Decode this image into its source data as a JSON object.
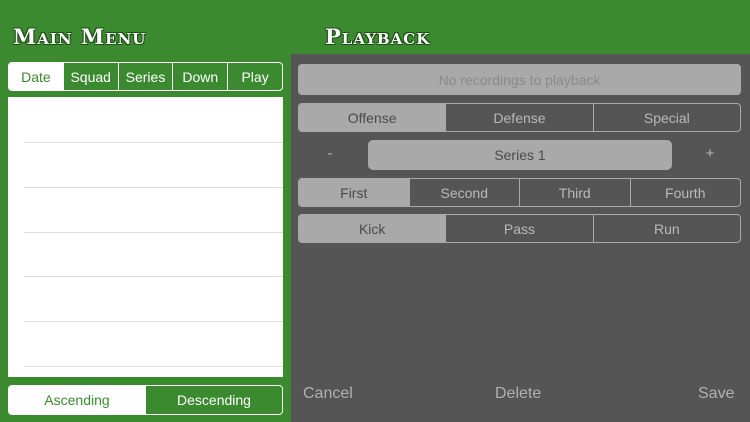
{
  "main_menu": {
    "title": "Main Menu",
    "sort_tabs": [
      {
        "label": "Date",
        "active": true
      },
      {
        "label": "Squad",
        "active": false
      },
      {
        "label": "Series",
        "active": false
      },
      {
        "label": "Down",
        "active": false
      },
      {
        "label": "Play",
        "active": false
      }
    ],
    "order": {
      "ascending_label": "Ascending",
      "descending_label": "Descending",
      "selected": "Descending"
    }
  },
  "playback": {
    "title": "Playback",
    "status_text": "No recordings to playback",
    "unit_tabs": [
      {
        "label": "Offense",
        "active": true
      },
      {
        "label": "Defense",
        "active": false
      },
      {
        "label": "Special",
        "active": false
      }
    ],
    "series": {
      "minus_label": "-",
      "value": "Series 1",
      "plus_label": "+"
    },
    "down_tabs": [
      {
        "label": "First",
        "active": true
      },
      {
        "label": "Second",
        "active": false
      },
      {
        "label": "Third",
        "active": false
      },
      {
        "label": "Fourth",
        "active": false
      }
    ],
    "play_tabs": [
      {
        "label": "Kick",
        "active": true
      },
      {
        "label": "Pass",
        "active": false
      },
      {
        "label": "Run",
        "active": false
      }
    ],
    "actions": {
      "cancel": "Cancel",
      "delete": "Delete",
      "save": "Save"
    }
  },
  "colors": {
    "brand_green": "#3c8a2f",
    "panel_gray": "#555555",
    "control_gray": "#a9a9a9"
  }
}
